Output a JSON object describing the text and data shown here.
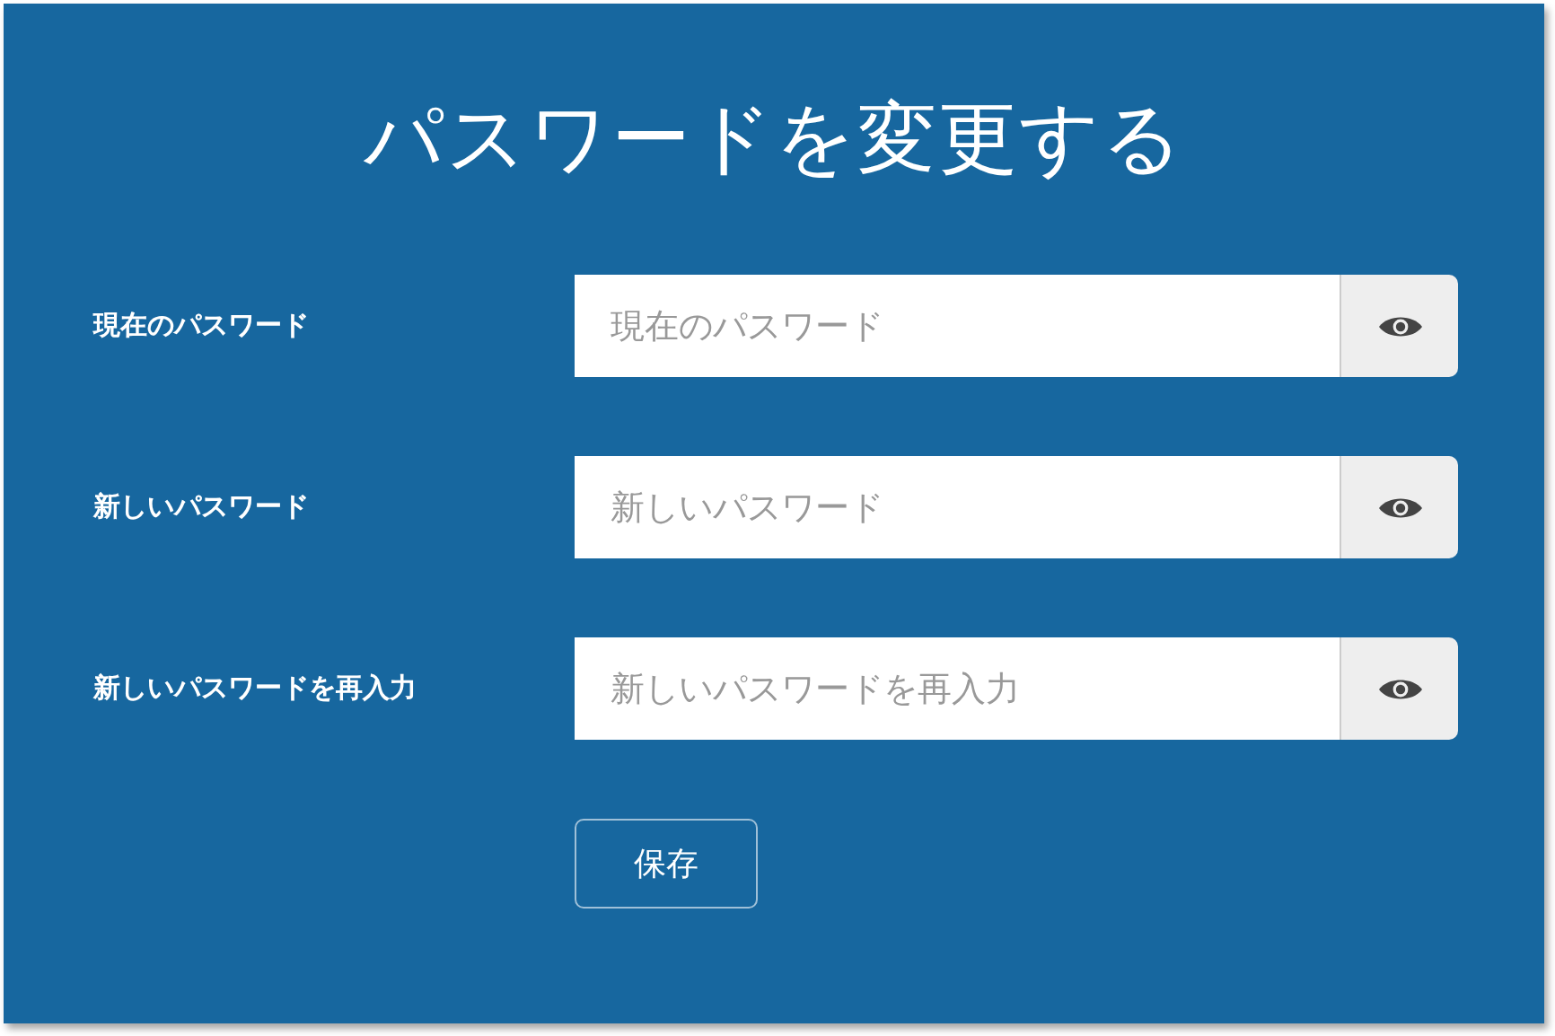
{
  "title": "パスワードを変更する",
  "fields": [
    {
      "label": "現在のパスワード",
      "placeholder": "現在のパスワード"
    },
    {
      "label": "新しいパスワード",
      "placeholder": "新しいパスワード"
    },
    {
      "label": "新しいパスワードを再入力",
      "placeholder": "新しいパスワードを再入力"
    }
  ],
  "save_button": "保存"
}
